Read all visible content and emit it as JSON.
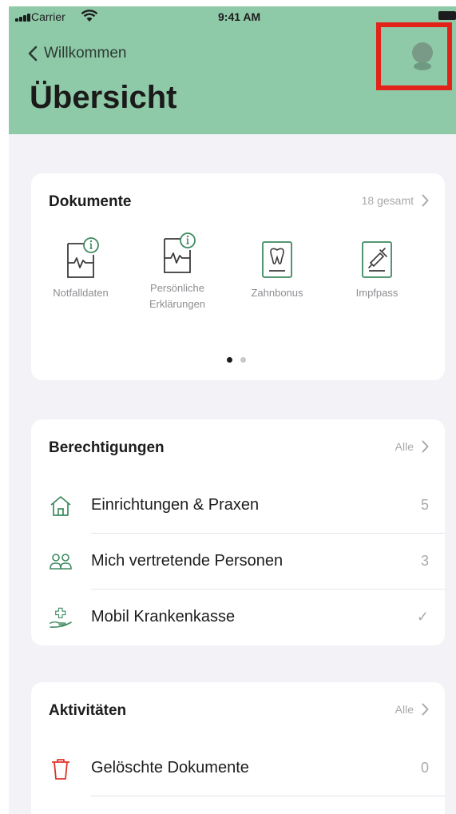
{
  "status_bar": {
    "carrier": "Carrier",
    "time": "9:41 AM"
  },
  "nav": {
    "back_label": "Willkommen",
    "title": "Übersicht"
  },
  "documents": {
    "title": "Dokumente",
    "total_label": "18 gesamt",
    "items": [
      {
        "label": "Notfalldaten",
        "icon": "notfalldaten-icon"
      },
      {
        "label": "Persönliche Erklärungen",
        "icon": "persoenliche-erklaerungen-icon"
      },
      {
        "label": "Zahnbonus",
        "icon": "zahnbonus-icon"
      },
      {
        "label": "Impfpass",
        "icon": "impfpass-icon"
      }
    ],
    "page_count": 2,
    "active_page": 1
  },
  "permissions": {
    "title": "Berechtigungen",
    "link_label": "Alle",
    "items": [
      {
        "label": "Einrichtungen & Praxen",
        "value": "5",
        "icon": "house-icon"
      },
      {
        "label": "Mich vertretende Personen",
        "value": "3",
        "icon": "people-icon"
      },
      {
        "label": "Mobil Krankenkasse",
        "value": "✓",
        "icon": "insurance-hand-icon"
      }
    ]
  },
  "activities": {
    "title": "Aktivitäten",
    "link_label": "Alle",
    "items": [
      {
        "label": "Gelöschte Dokumente",
        "value": "0",
        "icon": "trash-icon"
      }
    ]
  },
  "colors": {
    "header_bg": "#8fcaa8",
    "accent_green": "#3d8a60",
    "highlight_red": "#e2231a",
    "trash_red": "#e0342b"
  }
}
